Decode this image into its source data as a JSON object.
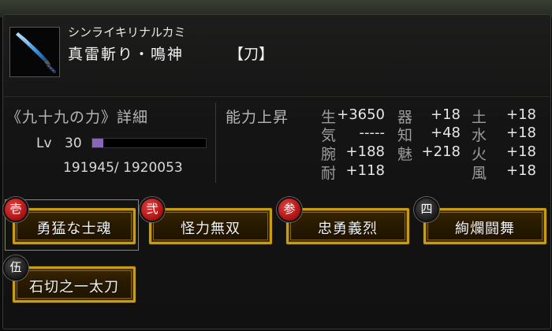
{
  "weapon": {
    "icon": "katana-icon",
    "kana": "シンライキリナルカミ",
    "name": "真雷斬り・鳴神",
    "type": "【刀】"
  },
  "detail": {
    "title": "《九十九の力》詳細",
    "level_label": "Lv",
    "level": "30",
    "exp_text": "191945/ 1920053",
    "exp_fraction": 0.1,
    "exp_bar_color": "#8a66b8"
  },
  "stats": {
    "title": "能力上昇",
    "items": [
      {
        "label": "生",
        "value": "+3650"
      },
      {
        "label": "器",
        "value": "+18"
      },
      {
        "label": "土",
        "value": "+18"
      },
      {
        "label": "気",
        "value": "-----"
      },
      {
        "label": "知",
        "value": "+48"
      },
      {
        "label": "水",
        "value": "+18"
      },
      {
        "label": "腕",
        "value": "+188"
      },
      {
        "label": "魅",
        "value": "+218"
      },
      {
        "label": "火",
        "value": "+18"
      },
      {
        "label": "耐",
        "value": "+118"
      },
      {
        "label": "風",
        "value": "+18"
      }
    ]
  },
  "skills": [
    {
      "badge": "壱",
      "label": "勇猛な士魂"
    },
    {
      "badge": "弐",
      "label": "怪力無双"
    },
    {
      "badge": "参",
      "label": "忠勇義烈"
    },
    {
      "badge": "四",
      "label": "絢爛闘舞"
    },
    {
      "badge": "伍",
      "label": "石切之一太刀"
    }
  ],
  "colors": {
    "button_border": "#c99a14",
    "badge_red": "#c41a1a",
    "badge_dark": "#222222"
  }
}
